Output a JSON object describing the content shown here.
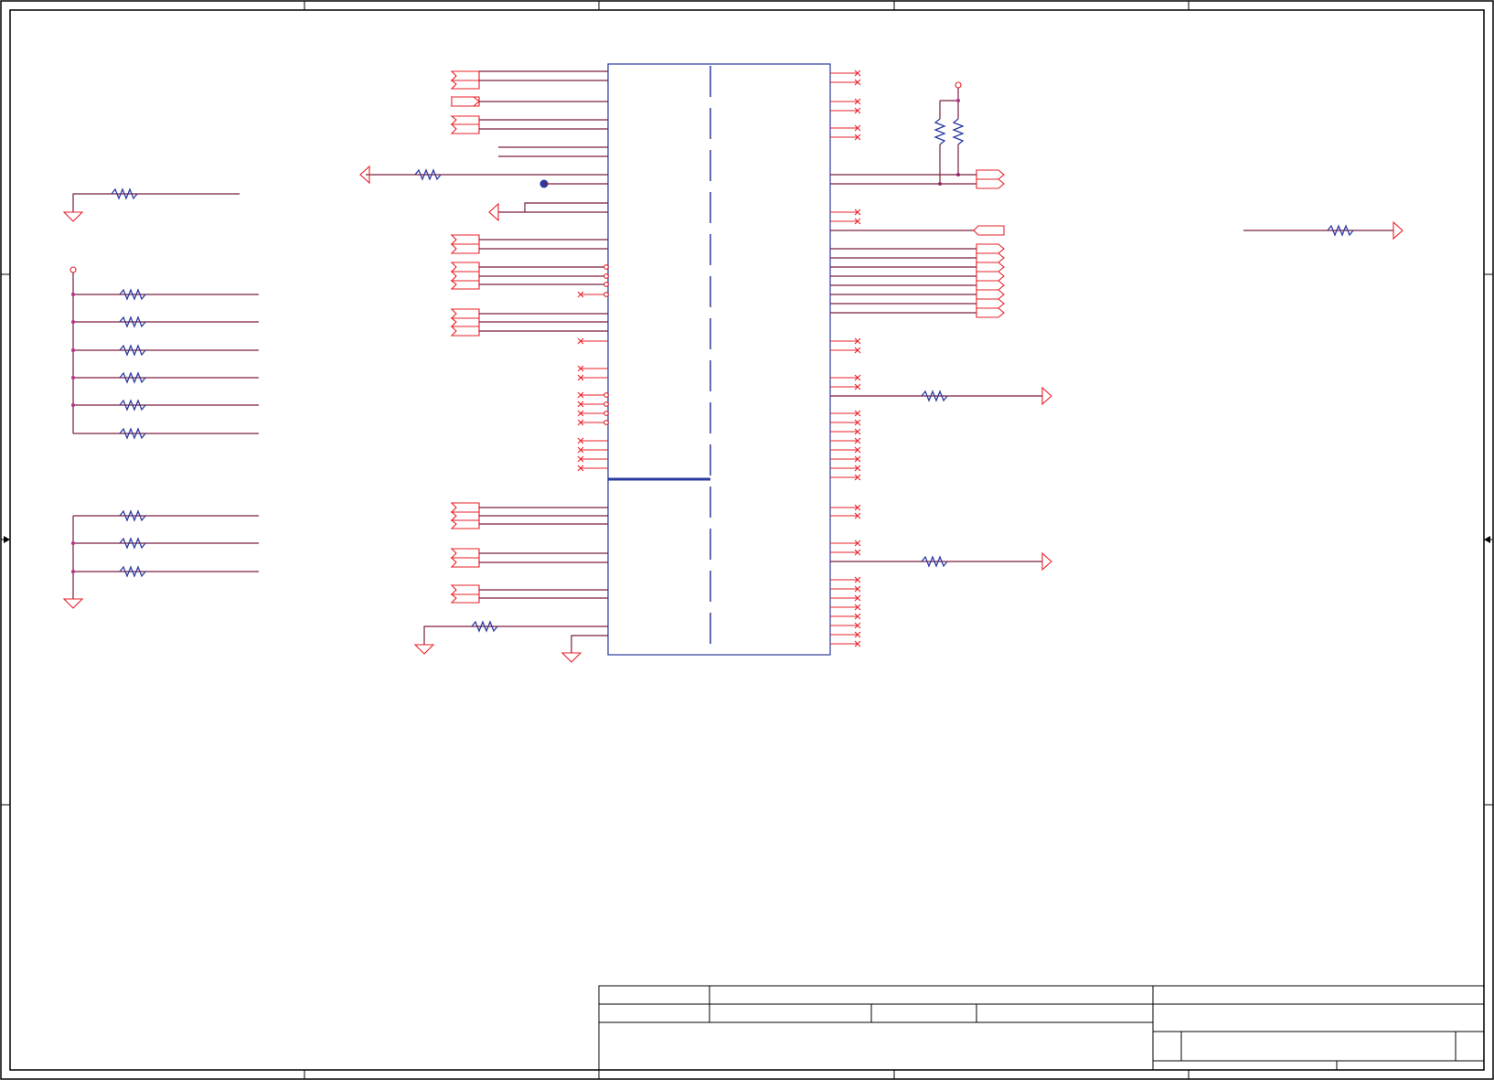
{
  "page": {
    "background": "#ffffff"
  },
  "colors": {
    "frame": "#000000",
    "wire": "#7a1f3d",
    "pin": "#e8202a",
    "component": "#2b3a9e",
    "junction": "#b2338a"
  },
  "icons": {
    "ground": "ground-icon",
    "power": "power-rail-icon",
    "resistor": "resistor-icon",
    "port": "offpage-port-icon",
    "no_connect": "no-connect-icon"
  }
}
